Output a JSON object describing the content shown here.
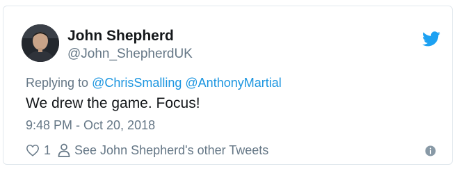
{
  "tweet": {
    "author_name": "John Shepherd",
    "author_handle": "@John_ShepherdUK",
    "replying_label": "Replying to",
    "replying_mentions": [
      "@ChrisSmalling",
      "@AnthonyMartial"
    ],
    "text": "We drew the game. Focus!",
    "timestamp": "9:48 PM - Oct 20, 2018",
    "like_count": "1",
    "other_tweets_label": "See John Shepherd's other Tweets"
  },
  "icons": {
    "brand": "twitter-bird-icon",
    "like": "heart-icon",
    "profile": "person-icon",
    "info": "info-icon"
  },
  "colors": {
    "brand": "#1da1f2",
    "link": "#1b95e0",
    "text": "#14171a",
    "muted": "#657786"
  }
}
